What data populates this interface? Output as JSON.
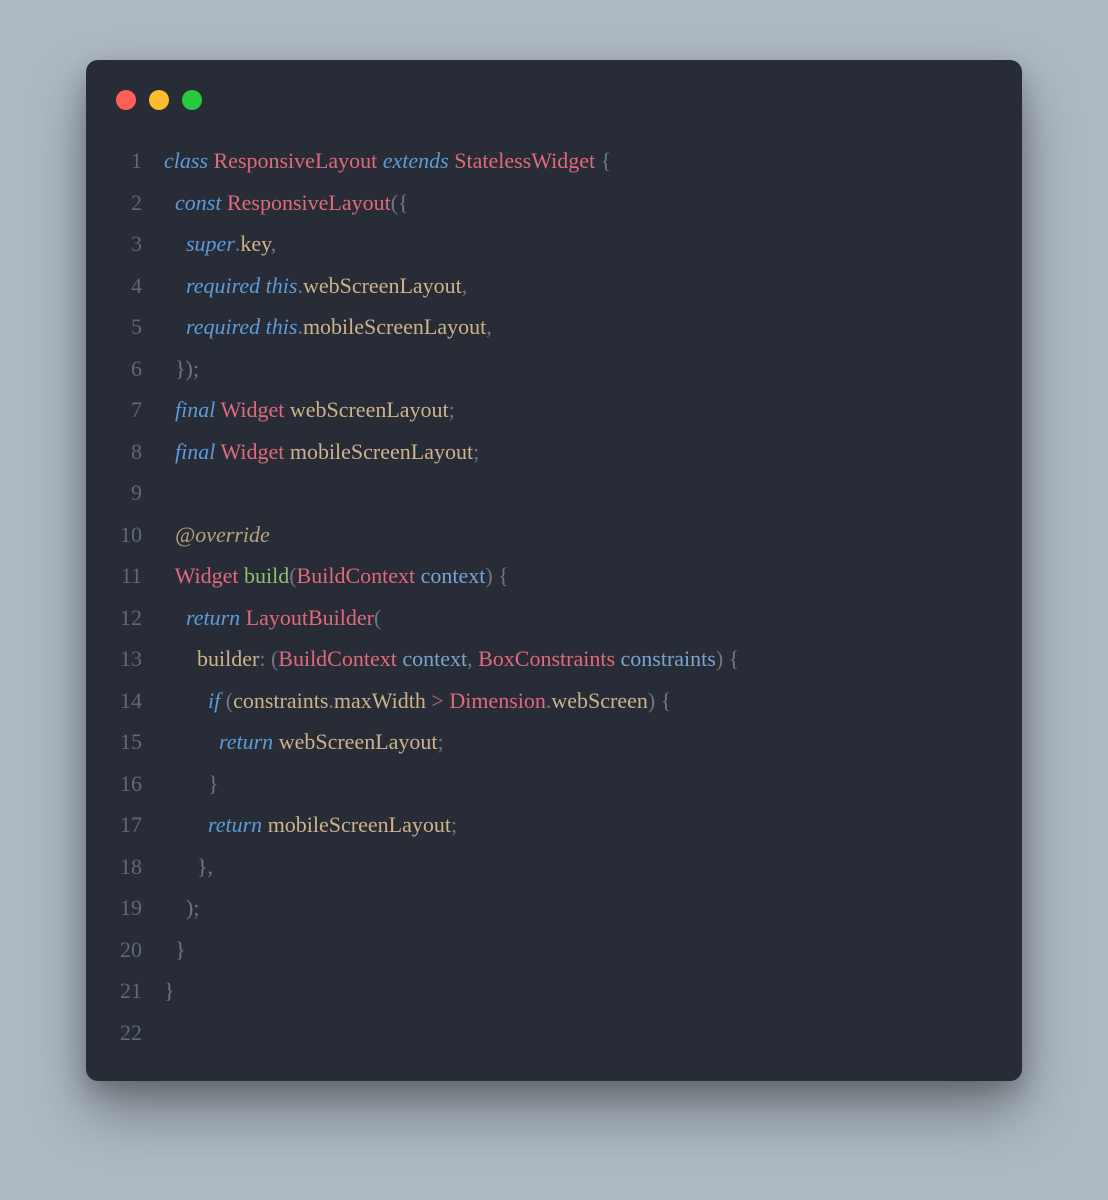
{
  "colors": {
    "bg": "#282c37",
    "gutter": "#5f6874",
    "keyword": "#5d9bd8",
    "type": "#e0697b",
    "func": "#8ebd6f",
    "ident": "#cdb28b",
    "param": "#7aa4cf",
    "punct": "#6f7682",
    "operator": "#b96b7f",
    "annotation": "#b7a17e"
  },
  "code": {
    "lines": [
      {
        "n": "1",
        "indent": "",
        "tokens": [
          [
            "k",
            "class"
          ],
          [
            "",
            ""
          ],
          [
            "cls",
            "ResponsiveLayout"
          ],
          [
            "",
            ""
          ],
          [
            "k",
            "extends"
          ],
          [
            "",
            ""
          ],
          [
            "cls",
            "StatelessWidget"
          ],
          [
            "",
            ""
          ],
          [
            "pn",
            "{"
          ]
        ]
      },
      {
        "n": "2",
        "indent": "  ",
        "tokens": [
          [
            "k",
            "const"
          ],
          [
            "",
            ""
          ],
          [
            "cls",
            "ResponsiveLayout"
          ],
          [
            "pn",
            "({"
          ]
        ]
      },
      {
        "n": "3",
        "indent": "    ",
        "tokens": [
          [
            "k",
            "super"
          ],
          [
            "pn",
            "."
          ],
          [
            "id",
            "key"
          ],
          [
            "pn",
            ","
          ]
        ]
      },
      {
        "n": "4",
        "indent": "    ",
        "tokens": [
          [
            "k",
            "required"
          ],
          [
            "",
            ""
          ],
          [
            "k",
            "this"
          ],
          [
            "pn",
            "."
          ],
          [
            "id",
            "webScreenLayout"
          ],
          [
            "pn",
            ","
          ]
        ]
      },
      {
        "n": "5",
        "indent": "    ",
        "tokens": [
          [
            "k",
            "required"
          ],
          [
            "",
            ""
          ],
          [
            "k",
            "this"
          ],
          [
            "pn",
            "."
          ],
          [
            "id",
            "mobileScreenLayout"
          ],
          [
            "pn",
            ","
          ]
        ]
      },
      {
        "n": "6",
        "indent": "  ",
        "tokens": [
          [
            "pn",
            "});"
          ]
        ]
      },
      {
        "n": "7",
        "indent": "  ",
        "tokens": [
          [
            "k",
            "final"
          ],
          [
            "",
            ""
          ],
          [
            "cls",
            "Widget"
          ],
          [
            "",
            ""
          ],
          [
            "id",
            "webScreenLayout"
          ],
          [
            "pn",
            ";"
          ]
        ]
      },
      {
        "n": "8",
        "indent": "  ",
        "tokens": [
          [
            "k",
            "final"
          ],
          [
            "",
            ""
          ],
          [
            "cls",
            "Widget"
          ],
          [
            "",
            ""
          ],
          [
            "id",
            "mobileScreenLayout"
          ],
          [
            "pn",
            ";"
          ]
        ]
      },
      {
        "n": "9",
        "indent": "",
        "tokens": []
      },
      {
        "n": "10",
        "indent": "  ",
        "tokens": [
          [
            "ann",
            "@override"
          ]
        ]
      },
      {
        "n": "11",
        "indent": "  ",
        "tokens": [
          [
            "cls",
            "Widget"
          ],
          [
            "",
            ""
          ],
          [
            "fn",
            "build"
          ],
          [
            "pn",
            "("
          ],
          [
            "cls",
            "BuildContext"
          ],
          [
            "",
            ""
          ],
          [
            "pr",
            "context"
          ],
          [
            "pn",
            ")"
          ],
          [
            "",
            ""
          ],
          [
            "pn",
            "{"
          ]
        ]
      },
      {
        "n": "12",
        "indent": "    ",
        "tokens": [
          [
            "k",
            "return"
          ],
          [
            "",
            ""
          ],
          [
            "cls",
            "LayoutBuilder"
          ],
          [
            "pn",
            "("
          ]
        ]
      },
      {
        "n": "13",
        "indent": "      ",
        "tokens": [
          [
            "id",
            "builder"
          ],
          [
            "pn",
            ":"
          ],
          [
            "",
            ""
          ],
          [
            "pn",
            "("
          ],
          [
            "cls",
            "BuildContext"
          ],
          [
            "",
            ""
          ],
          [
            "pr",
            "context"
          ],
          [
            "pn",
            ","
          ],
          [
            "",
            ""
          ],
          [
            "cls",
            "BoxConstraints"
          ],
          [
            "",
            ""
          ],
          [
            "pr",
            "constraints"
          ],
          [
            "pn",
            ")"
          ],
          [
            "",
            ""
          ],
          [
            "pn",
            "{"
          ]
        ]
      },
      {
        "n": "14",
        "indent": "        ",
        "tokens": [
          [
            "k",
            "if"
          ],
          [
            "",
            ""
          ],
          [
            "pn",
            "("
          ],
          [
            "id",
            "constraints"
          ],
          [
            "pn",
            "."
          ],
          [
            "id",
            "maxWidth"
          ],
          [
            "",
            ""
          ],
          [
            "op",
            ">"
          ],
          [
            "",
            ""
          ],
          [
            "cls",
            "Dimension"
          ],
          [
            "pn",
            "."
          ],
          [
            "id",
            "webScreen"
          ],
          [
            "pn",
            ")"
          ],
          [
            "",
            ""
          ],
          [
            "pn",
            "{"
          ]
        ]
      },
      {
        "n": "15",
        "indent": "          ",
        "tokens": [
          [
            "k",
            "return"
          ],
          [
            "",
            ""
          ],
          [
            "id",
            "webScreenLayout"
          ],
          [
            "pn",
            ";"
          ]
        ]
      },
      {
        "n": "16",
        "indent": "        ",
        "tokens": [
          [
            "pn",
            "}"
          ]
        ]
      },
      {
        "n": "17",
        "indent": "        ",
        "tokens": [
          [
            "k",
            "return"
          ],
          [
            "",
            ""
          ],
          [
            "id",
            "mobileScreenLayout"
          ],
          [
            "pn",
            ";"
          ]
        ]
      },
      {
        "n": "18",
        "indent": "      ",
        "tokens": [
          [
            "pn",
            "},"
          ]
        ]
      },
      {
        "n": "19",
        "indent": "    ",
        "tokens": [
          [
            "pn",
            ");"
          ]
        ]
      },
      {
        "n": "20",
        "indent": "  ",
        "tokens": [
          [
            "pn",
            "}"
          ]
        ]
      },
      {
        "n": "21",
        "indent": "",
        "tokens": [
          [
            "pn",
            "}"
          ]
        ]
      },
      {
        "n": "22",
        "indent": "",
        "tokens": []
      }
    ]
  }
}
